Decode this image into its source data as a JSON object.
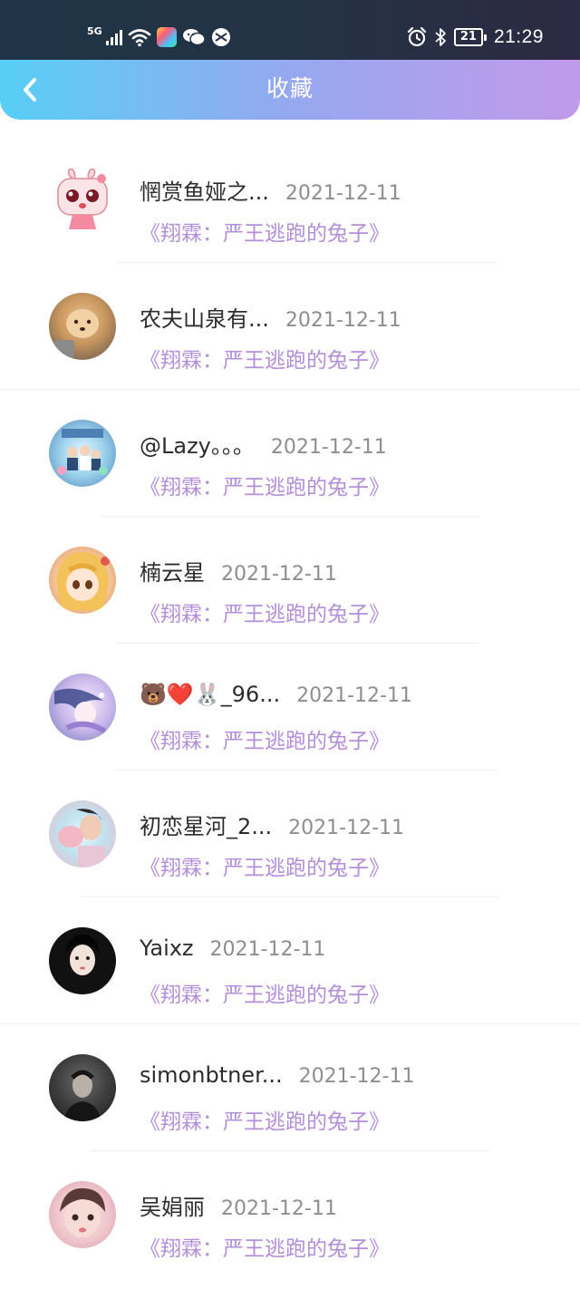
{
  "status_bar": {
    "network": "5G",
    "battery": "21",
    "time": "21:29"
  },
  "header": {
    "title": "收藏"
  },
  "items": [
    {
      "name": "惘赏鱼娅之...",
      "date": "2021-12-11",
      "book": "《翔霖：严王逃跑的兔子》",
      "avatar": "cartoon-bunny-avatar"
    },
    {
      "name": "农夫山泉有...",
      "date": "2021-12-11",
      "book": "《翔霖：严王逃跑的兔子》",
      "avatar": "shiba-dog-avatar"
    },
    {
      "name": "@Lazy。。。",
      "date": "2021-12-11",
      "book": "《翔霖：严王逃跑的兔子》",
      "avatar": "group-photo-avatar"
    },
    {
      "name": "楠云星",
      "date": "2021-12-11",
      "book": "《翔霖：严王逃跑的兔子》",
      "avatar": "anime-girl-avatar"
    },
    {
      "name": "🐻❤️🐰_96...",
      "date": "2021-12-11",
      "book": "《翔霖：严王逃跑的兔子》",
      "avatar": "illustration-avatar"
    },
    {
      "name": "初恋星河_2...",
      "date": "2021-12-11",
      "book": "《翔霖：严王逃跑的兔子》",
      "avatar": "pink-photo-avatar"
    },
    {
      "name": "Yaixz",
      "date": "2021-12-11",
      "book": "《翔霖：严王逃跑的兔子》",
      "avatar": "dark-portrait-avatar"
    },
    {
      "name": "simonbtner...",
      "date": "2021-12-11",
      "book": "《翔霖：严王逃跑的兔子》",
      "avatar": "gray-portrait-avatar"
    },
    {
      "name": "吴娟丽",
      "date": "2021-12-11",
      "book": "《翔霖：严王逃跑的兔子》",
      "avatar": "selfie-avatar"
    }
  ],
  "colors": {
    "header_gradient": [
      "#57cff5",
      "#96a8ef",
      "#c19aea"
    ],
    "book_title": "#b58ed9",
    "name": "#2c2c2c",
    "date": "#8e8e8e"
  }
}
